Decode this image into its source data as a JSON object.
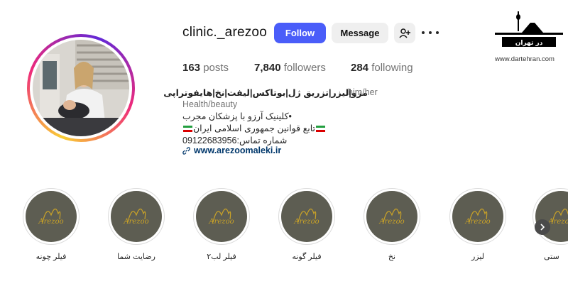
{
  "profile": {
    "username": "clinic._arezoo",
    "follow_label": "Follow",
    "message_label": "Message",
    "posts_count": "163",
    "posts_label": "posts",
    "followers_count": "7,840",
    "followers_label": "followers",
    "following_count": "284",
    "following_label": "following",
    "bio_title": "مزو|لیزر|تزریق ژل|بوتاکس|لیفت|نخ|هایفوتراپی",
    "pronouns": "him/her",
    "category": "Health/beauty",
    "bio_line_1": "•کلینیک آرزو با پزشکان مجرب",
    "bio_line_2": "تابع قوانین جمهوری اسلامی ایران",
    "bio_line_3": "شماره تماس:09122683956",
    "website": "www.arezoomaleki.ir"
  },
  "watermark": {
    "brand": "در تهران",
    "url": "www.dartehran.com"
  },
  "highlights": [
    {
      "label": "فیلر چونه",
      "logo": "Arezoo"
    },
    {
      "label": "رضایت شما",
      "logo": "Arezoo"
    },
    {
      "label": "فیلر لب۲",
      "logo": "Arezoo"
    },
    {
      "label": "فیلر گونه",
      "logo": "Arezoo"
    },
    {
      "label": "نخ",
      "logo": "Arezoo"
    },
    {
      "label": "لیزر",
      "logo": "Arezoo"
    },
    {
      "label": "ستی",
      "logo": "Arezoo"
    }
  ],
  "icons": {
    "add_user": "add-user-icon",
    "more": "more-options-icon",
    "link": "link-icon",
    "next": "chevron-right-icon"
  },
  "colors": {
    "follow_button": "#4a5df9",
    "secondary_button": "#efefef",
    "link": "#00376b",
    "highlight_bg": "#5d5d52",
    "logo_gold": "#c9a227"
  }
}
